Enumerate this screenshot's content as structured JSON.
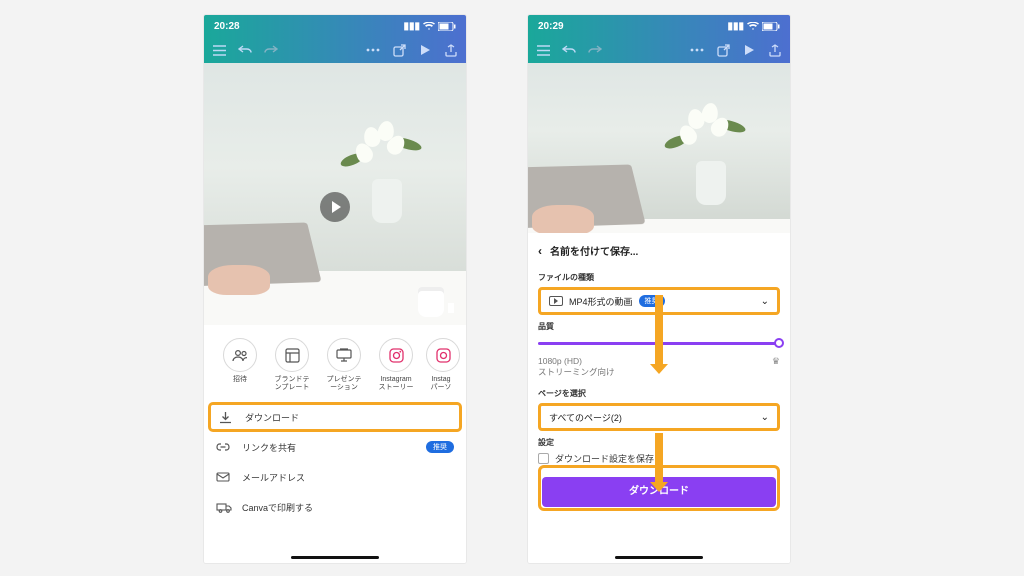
{
  "left": {
    "time": "20:28",
    "share_items": [
      {
        "icon": "users",
        "label": "招待"
      },
      {
        "icon": "template",
        "label": "ブランドテ\nンプレート"
      },
      {
        "icon": "present",
        "label": "プレゼンテ\nーション"
      },
      {
        "icon": "instagram",
        "label": "Instagram\nストーリー"
      },
      {
        "icon": "instagram",
        "label": "Instag\nパーソ"
      }
    ],
    "options": {
      "download": "ダウンロード",
      "share_link": "リンクを共有",
      "share_link_badge": "推奨",
      "email": "メールアドレス",
      "print": "Canvaで印刷する"
    }
  },
  "right": {
    "time": "20:29",
    "sheet_title": "名前を付けて保存...",
    "file_type_label": "ファイルの種類",
    "file_type_value": "MP4形式の動画",
    "file_type_badge": "推奨",
    "quality_label": "品質",
    "quality_value": "1080p (HD)",
    "quality_sub": "ストリーミング向け",
    "pages_label": "ページを選択",
    "pages_value": "すべてのページ(2)",
    "settings_label": "設定",
    "save_settings": "ダウンロード設定を保存",
    "download_btn": "ダウンロード"
  }
}
